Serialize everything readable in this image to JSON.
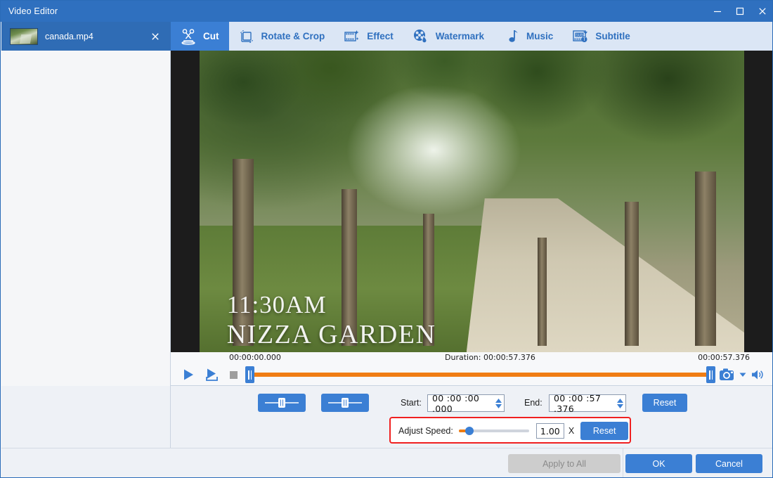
{
  "window": {
    "title": "Video Editor",
    "minimize_icon": "minimize-icon",
    "maximize_icon": "maximize-icon",
    "close_icon": "close-icon",
    "accent_color": "#3b7fd4",
    "titlebar_color": "#2f70bf",
    "highlight_color": "#f02020",
    "timeline_color": "#f07d13"
  },
  "sidebar": {
    "files": [
      {
        "name": "canada.mp4",
        "close_icon": "close-icon",
        "thumbnail": "video-thumbnail",
        "selected": true
      }
    ]
  },
  "tabs": [
    {
      "label": "Cut",
      "icon": "scissors-icon",
      "active": true
    },
    {
      "label": "Rotate & Crop",
      "icon": "crop-rotate-icon",
      "active": false
    },
    {
      "label": "Effect",
      "icon": "film-sparkle-icon",
      "active": false
    },
    {
      "label": "Watermark",
      "icon": "watermark-drop-icon",
      "active": false
    },
    {
      "label": "Music",
      "icon": "music-note-icon",
      "active": false
    },
    {
      "label": "Subtitle",
      "icon": "subtitle-icon",
      "active": false
    }
  ],
  "preview": {
    "overlay_line1": "11:30AM",
    "overlay_line2": "NIZZA GARDEN"
  },
  "timeline": {
    "start_time": "00:00:00.000",
    "duration_label": "Duration: 00:00:57.376",
    "end_time": "00:00:57.376",
    "play_icon": "play-icon",
    "play_selection_icon": "play-selection-icon",
    "stop_icon": "stop-icon",
    "snapshot_icon": "camera-icon",
    "snapshot_dropdown_icon": "chevron-down-icon",
    "volume_icon": "volume-icon",
    "left_handle": "trim-handle-left",
    "right_handle": "trim-handle-right"
  },
  "controls": {
    "set_start_button": "set-start-marker",
    "set_end_button": "set-end-marker",
    "start_label": "Start:",
    "start_value": "00 :00 :00 .000",
    "end_label": "End:",
    "end_value": "00 :00 :57 .376",
    "reset_label": "Reset",
    "speed": {
      "label": "Adjust Speed:",
      "value": "1.00",
      "unit": "X",
      "reset_label": "Reset",
      "slider_percent": 10
    }
  },
  "footer": {
    "apply_to_all_label": "Apply to All",
    "apply_to_all_enabled": false,
    "ok_label": "OK",
    "cancel_label": "Cancel"
  }
}
